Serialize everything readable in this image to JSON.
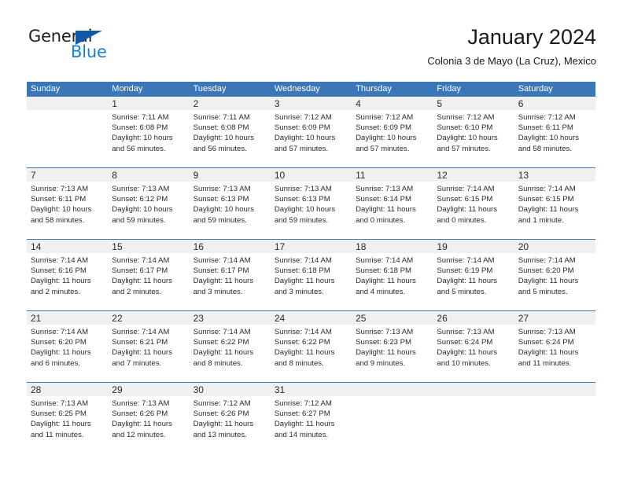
{
  "logo": {
    "word_top": "General",
    "word_bottom": "Blue",
    "triangle_color": "#1059a8",
    "blue_color": "#1a7fd4"
  },
  "header": {
    "month_title": "January 2024",
    "location": "Colonia 3 de Mayo (La Cruz), Mexico"
  },
  "theme": {
    "header_blue": "#3a76b8",
    "daynum_band": "#f0f0f0",
    "separator": "#3a76b8",
    "text": "#2b2b2b"
  },
  "weekday_headers": [
    "Sunday",
    "Monday",
    "Tuesday",
    "Wednesday",
    "Thursday",
    "Friday",
    "Saturday"
  ],
  "weeks": [
    [
      {
        "day": "",
        "sunrise": "",
        "sunset": "",
        "daylight_1": "",
        "daylight_2": "",
        "empty": true
      },
      {
        "day": "1",
        "sunrise": "Sunrise: 7:11 AM",
        "sunset": "Sunset: 6:08 PM",
        "daylight_1": "Daylight: 10 hours",
        "daylight_2": "and 56 minutes."
      },
      {
        "day": "2",
        "sunrise": "Sunrise: 7:11 AM",
        "sunset": "Sunset: 6:08 PM",
        "daylight_1": "Daylight: 10 hours",
        "daylight_2": "and 56 minutes."
      },
      {
        "day": "3",
        "sunrise": "Sunrise: 7:12 AM",
        "sunset": "Sunset: 6:09 PM",
        "daylight_1": "Daylight: 10 hours",
        "daylight_2": "and 57 minutes."
      },
      {
        "day": "4",
        "sunrise": "Sunrise: 7:12 AM",
        "sunset": "Sunset: 6:09 PM",
        "daylight_1": "Daylight: 10 hours",
        "daylight_2": "and 57 minutes."
      },
      {
        "day": "5",
        "sunrise": "Sunrise: 7:12 AM",
        "sunset": "Sunset: 6:10 PM",
        "daylight_1": "Daylight: 10 hours",
        "daylight_2": "and 57 minutes."
      },
      {
        "day": "6",
        "sunrise": "Sunrise: 7:12 AM",
        "sunset": "Sunset: 6:11 PM",
        "daylight_1": "Daylight: 10 hours",
        "daylight_2": "and 58 minutes."
      }
    ],
    [
      {
        "day": "7",
        "sunrise": "Sunrise: 7:13 AM",
        "sunset": "Sunset: 6:11 PM",
        "daylight_1": "Daylight: 10 hours",
        "daylight_2": "and 58 minutes."
      },
      {
        "day": "8",
        "sunrise": "Sunrise: 7:13 AM",
        "sunset": "Sunset: 6:12 PM",
        "daylight_1": "Daylight: 10 hours",
        "daylight_2": "and 59 minutes."
      },
      {
        "day": "9",
        "sunrise": "Sunrise: 7:13 AM",
        "sunset": "Sunset: 6:13 PM",
        "daylight_1": "Daylight: 10 hours",
        "daylight_2": "and 59 minutes."
      },
      {
        "day": "10",
        "sunrise": "Sunrise: 7:13 AM",
        "sunset": "Sunset: 6:13 PM",
        "daylight_1": "Daylight: 10 hours",
        "daylight_2": "and 59 minutes."
      },
      {
        "day": "11",
        "sunrise": "Sunrise: 7:13 AM",
        "sunset": "Sunset: 6:14 PM",
        "daylight_1": "Daylight: 11 hours",
        "daylight_2": "and 0 minutes."
      },
      {
        "day": "12",
        "sunrise": "Sunrise: 7:14 AM",
        "sunset": "Sunset: 6:15 PM",
        "daylight_1": "Daylight: 11 hours",
        "daylight_2": "and 0 minutes."
      },
      {
        "day": "13",
        "sunrise": "Sunrise: 7:14 AM",
        "sunset": "Sunset: 6:15 PM",
        "daylight_1": "Daylight: 11 hours",
        "daylight_2": "and 1 minute."
      }
    ],
    [
      {
        "day": "14",
        "sunrise": "Sunrise: 7:14 AM",
        "sunset": "Sunset: 6:16 PM",
        "daylight_1": "Daylight: 11 hours",
        "daylight_2": "and 2 minutes."
      },
      {
        "day": "15",
        "sunrise": "Sunrise: 7:14 AM",
        "sunset": "Sunset: 6:17 PM",
        "daylight_1": "Daylight: 11 hours",
        "daylight_2": "and 2 minutes."
      },
      {
        "day": "16",
        "sunrise": "Sunrise: 7:14 AM",
        "sunset": "Sunset: 6:17 PM",
        "daylight_1": "Daylight: 11 hours",
        "daylight_2": "and 3 minutes."
      },
      {
        "day": "17",
        "sunrise": "Sunrise: 7:14 AM",
        "sunset": "Sunset: 6:18 PM",
        "daylight_1": "Daylight: 11 hours",
        "daylight_2": "and 3 minutes."
      },
      {
        "day": "18",
        "sunrise": "Sunrise: 7:14 AM",
        "sunset": "Sunset: 6:18 PM",
        "daylight_1": "Daylight: 11 hours",
        "daylight_2": "and 4 minutes."
      },
      {
        "day": "19",
        "sunrise": "Sunrise: 7:14 AM",
        "sunset": "Sunset: 6:19 PM",
        "daylight_1": "Daylight: 11 hours",
        "daylight_2": "and 5 minutes."
      },
      {
        "day": "20",
        "sunrise": "Sunrise: 7:14 AM",
        "sunset": "Sunset: 6:20 PM",
        "daylight_1": "Daylight: 11 hours",
        "daylight_2": "and 5 minutes."
      }
    ],
    [
      {
        "day": "21",
        "sunrise": "Sunrise: 7:14 AM",
        "sunset": "Sunset: 6:20 PM",
        "daylight_1": "Daylight: 11 hours",
        "daylight_2": "and 6 minutes."
      },
      {
        "day": "22",
        "sunrise": "Sunrise: 7:14 AM",
        "sunset": "Sunset: 6:21 PM",
        "daylight_1": "Daylight: 11 hours",
        "daylight_2": "and 7 minutes."
      },
      {
        "day": "23",
        "sunrise": "Sunrise: 7:14 AM",
        "sunset": "Sunset: 6:22 PM",
        "daylight_1": "Daylight: 11 hours",
        "daylight_2": "and 8 minutes."
      },
      {
        "day": "24",
        "sunrise": "Sunrise: 7:14 AM",
        "sunset": "Sunset: 6:22 PM",
        "daylight_1": "Daylight: 11 hours",
        "daylight_2": "and 8 minutes."
      },
      {
        "day": "25",
        "sunrise": "Sunrise: 7:13 AM",
        "sunset": "Sunset: 6:23 PM",
        "daylight_1": "Daylight: 11 hours",
        "daylight_2": "and 9 minutes."
      },
      {
        "day": "26",
        "sunrise": "Sunrise: 7:13 AM",
        "sunset": "Sunset: 6:24 PM",
        "daylight_1": "Daylight: 11 hours",
        "daylight_2": "and 10 minutes."
      },
      {
        "day": "27",
        "sunrise": "Sunrise: 7:13 AM",
        "sunset": "Sunset: 6:24 PM",
        "daylight_1": "Daylight: 11 hours",
        "daylight_2": "and 11 minutes."
      }
    ],
    [
      {
        "day": "28",
        "sunrise": "Sunrise: 7:13 AM",
        "sunset": "Sunset: 6:25 PM",
        "daylight_1": "Daylight: 11 hours",
        "daylight_2": "and 11 minutes."
      },
      {
        "day": "29",
        "sunrise": "Sunrise: 7:13 AM",
        "sunset": "Sunset: 6:26 PM",
        "daylight_1": "Daylight: 11 hours",
        "daylight_2": "and 12 minutes."
      },
      {
        "day": "30",
        "sunrise": "Sunrise: 7:12 AM",
        "sunset": "Sunset: 6:26 PM",
        "daylight_1": "Daylight: 11 hours",
        "daylight_2": "and 13 minutes."
      },
      {
        "day": "31",
        "sunrise": "Sunrise: 7:12 AM",
        "sunset": "Sunset: 6:27 PM",
        "daylight_1": "Daylight: 11 hours",
        "daylight_2": "and 14 minutes."
      },
      {
        "day": "",
        "sunrise": "",
        "sunset": "",
        "daylight_1": "",
        "daylight_2": "",
        "empty": true
      },
      {
        "day": "",
        "sunrise": "",
        "sunset": "",
        "daylight_1": "",
        "daylight_2": "",
        "empty": true
      },
      {
        "day": "",
        "sunrise": "",
        "sunset": "",
        "daylight_1": "",
        "daylight_2": "",
        "empty": true
      }
    ]
  ]
}
